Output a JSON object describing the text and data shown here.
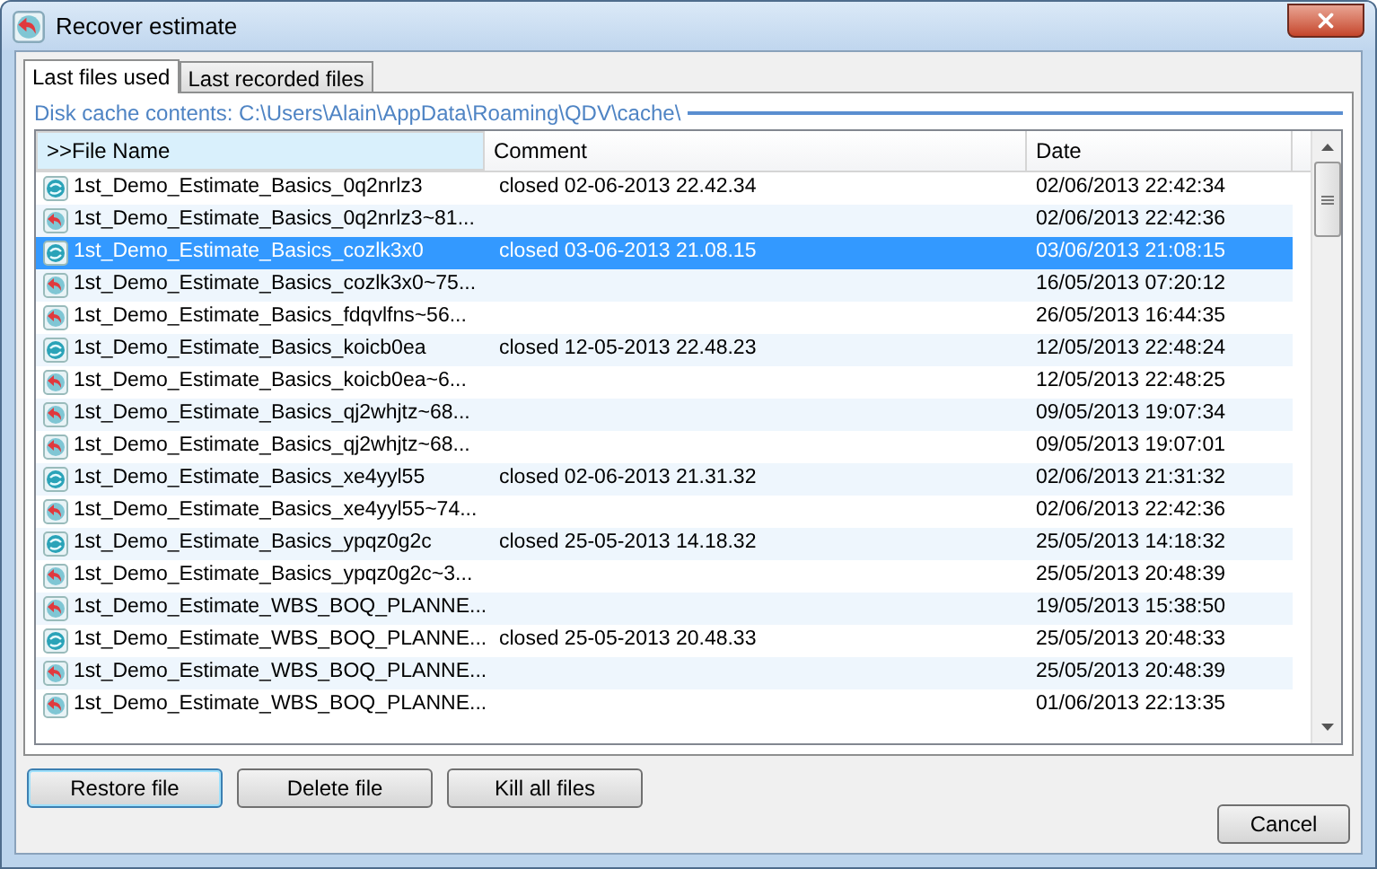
{
  "window": {
    "title": "Recover estimate"
  },
  "tabs": [
    {
      "label": "Last files used",
      "selected": true
    },
    {
      "label": "Last recorded files",
      "selected": false
    }
  ],
  "cache_label": "Disk cache contents: C:\\Users\\Alain\\AppData\\Roaming\\QDV\\cache\\",
  "columns": [
    ">>File Name",
    "Comment",
    "Date"
  ],
  "rows": [
    {
      "kind": "closed",
      "file_name": "1st_Demo_Estimate_Basics_0q2nrlz3",
      "comment": "closed 02-06-2013 22.42.34",
      "date": "02/06/2013 22:42:34",
      "selected": false
    },
    {
      "kind": "backup",
      "file_name": "1st_Demo_Estimate_Basics_0q2nrlz3~81...",
      "date": "02/06/2013 22:42:36",
      "selected": false
    },
    {
      "kind": "closed",
      "file_name": "1st_Demo_Estimate_Basics_cozlk3x0",
      "comment": "closed 03-06-2013 21.08.15",
      "date": "03/06/2013 21:08:15",
      "selected": true
    },
    {
      "kind": "backup",
      "file_name": "1st_Demo_Estimate_Basics_cozlk3x0~75...",
      "date": "16/05/2013 07:20:12",
      "selected": false
    },
    {
      "kind": "backup",
      "file_name": "1st_Demo_Estimate_Basics_fdqvlfns~56...",
      "date": "26/05/2013 16:44:35",
      "selected": false
    },
    {
      "kind": "closed",
      "file_name": "1st_Demo_Estimate_Basics_koicb0ea",
      "comment": "closed 12-05-2013 22.48.23",
      "date": "12/05/2013 22:48:24",
      "selected": false
    },
    {
      "kind": "backup",
      "file_name": "1st_Demo_Estimate_Basics_koicb0ea~6...",
      "date": "12/05/2013 22:48:25",
      "selected": false
    },
    {
      "kind": "backup",
      "file_name": "1st_Demo_Estimate_Basics_qj2whjtz~68...",
      "date": "09/05/2013 19:07:34",
      "selected": false
    },
    {
      "kind": "backup",
      "file_name": "1st_Demo_Estimate_Basics_qj2whjtz~68...",
      "date": "09/05/2013 19:07:01",
      "selected": false
    },
    {
      "kind": "closed",
      "file_name": "1st_Demo_Estimate_Basics_xe4yyl55",
      "comment": "closed 02-06-2013 21.31.32",
      "date": "02/06/2013 21:31:32",
      "selected": false
    },
    {
      "kind": "backup",
      "file_name": "1st_Demo_Estimate_Basics_xe4yyl55~74...",
      "date": "02/06/2013 22:42:36",
      "selected": false
    },
    {
      "kind": "closed",
      "file_name": "1st_Demo_Estimate_Basics_ypqz0g2c",
      "comment": "closed 25-05-2013 14.18.32",
      "date": "25/05/2013 14:18:32",
      "selected": false
    },
    {
      "kind": "backup",
      "file_name": "1st_Demo_Estimate_Basics_ypqz0g2c~3...",
      "date": "25/05/2013 20:48:39",
      "selected": false
    },
    {
      "kind": "backup",
      "file_name": "1st_Demo_Estimate_WBS_BOQ_PLANNE...",
      "date": "19/05/2013 15:38:50",
      "selected": false
    },
    {
      "kind": "closed",
      "file_name": "1st_Demo_Estimate_WBS_BOQ_PLANNE...",
      "comment": "closed 25-05-2013 20.48.33",
      "date": "25/05/2013 20:48:33",
      "selected": false
    },
    {
      "kind": "backup",
      "file_name": "1st_Demo_Estimate_WBS_BOQ_PLANNE...",
      "date": "25/05/2013 20:48:39",
      "selected": false
    },
    {
      "kind": "backup",
      "file_name": "1st_Demo_Estimate_WBS_BOQ_PLANNE...",
      "date": "01/06/2013 22:13:35",
      "selected": false
    }
  ],
  "buttons": [
    {
      "label": "Restore file",
      "default": true
    },
    {
      "label": "Delete file",
      "default": false
    },
    {
      "label": "Kill all files",
      "default": false
    }
  ],
  "cancel": "Cancel"
}
